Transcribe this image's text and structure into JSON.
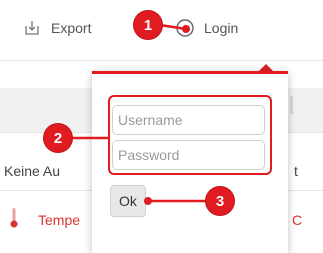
{
  "toolbar": {
    "export_label": "Export",
    "login_label": "Login",
    "export_icon": "download-icon",
    "login_icon": "sign-in-icon"
  },
  "background": {
    "keine_label": "Keine Au",
    "temp_label": "Tempe",
    "unit_fragment": "C",
    "right_fragment": "t"
  },
  "login_form": {
    "username_placeholder": "Username",
    "password_placeholder": "Password",
    "ok_label": "Ok"
  },
  "callouts": {
    "step1": "1",
    "step2": "2",
    "step3": "3"
  },
  "colors": {
    "accent": "#e01c21",
    "temperature_text": "#d9322e"
  }
}
